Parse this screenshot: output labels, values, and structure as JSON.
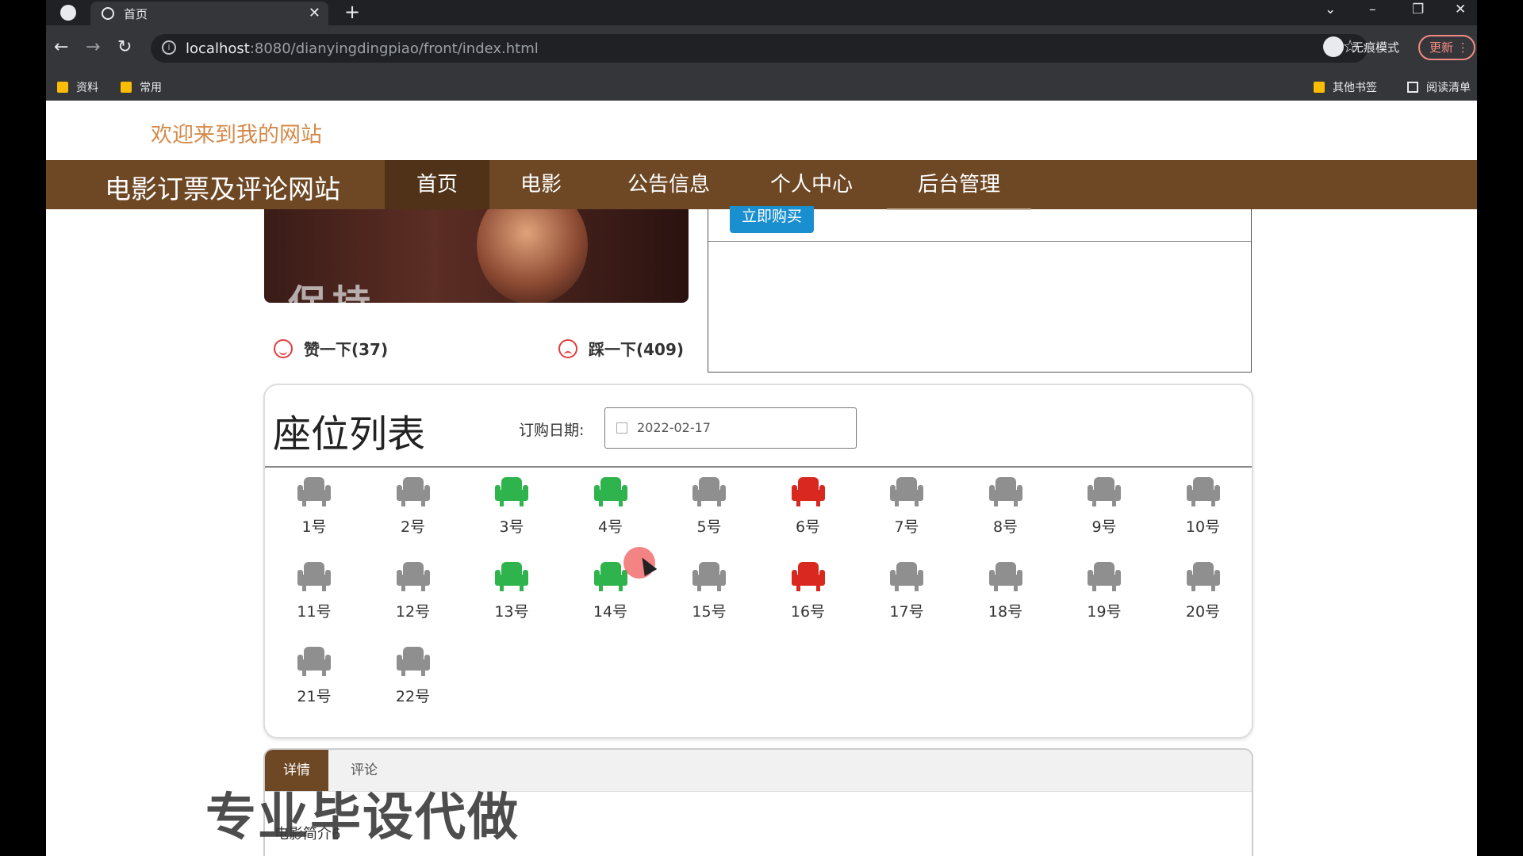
{
  "browser": {
    "tab_title": "首页",
    "url_host": "localhost",
    "url_rest": ":8080/dianyingdingpiao/front/index.html",
    "incognito_label": "无痕模式",
    "update_label": "更新",
    "bookmarks": [
      "资料",
      "常用"
    ],
    "bookmarks_right": [
      "其他书签",
      "阅读清单"
    ]
  },
  "header": {
    "welcome": "欢迎来到我的网站",
    "site_title": "电影订票及评论网站",
    "nav": [
      "首页",
      "电影",
      "公告信息",
      "个人中心",
      "后台管理"
    ]
  },
  "movie": {
    "like_label": "赞一下(37)",
    "dislike_label": "踩一下(409)",
    "buy_label": "立即购买"
  },
  "seats": {
    "title": "座位列表",
    "date_label": "订购日期:",
    "date_value": "2022-02-17",
    "colors": {
      "available": "#8f8f8f",
      "selected": "#2fb44d",
      "sold": "#d9281f"
    },
    "items": [
      {
        "label": "1号",
        "status": "available"
      },
      {
        "label": "2号",
        "status": "available"
      },
      {
        "label": "3号",
        "status": "selected"
      },
      {
        "label": "4号",
        "status": "selected"
      },
      {
        "label": "5号",
        "status": "available"
      },
      {
        "label": "6号",
        "status": "sold"
      },
      {
        "label": "7号",
        "status": "available"
      },
      {
        "label": "8号",
        "status": "available"
      },
      {
        "label": "9号",
        "status": "available"
      },
      {
        "label": "10号",
        "status": "available"
      },
      {
        "label": "11号",
        "status": "available"
      },
      {
        "label": "12号",
        "status": "available"
      },
      {
        "label": "13号",
        "status": "selected"
      },
      {
        "label": "14号",
        "status": "selected"
      },
      {
        "label": "15号",
        "status": "available"
      },
      {
        "label": "16号",
        "status": "sold"
      },
      {
        "label": "17号",
        "status": "available"
      },
      {
        "label": "18号",
        "status": "available"
      },
      {
        "label": "19号",
        "status": "available"
      },
      {
        "label": "20号",
        "status": "available"
      },
      {
        "label": "21号",
        "status": "available"
      },
      {
        "label": "22号",
        "status": "available"
      }
    ]
  },
  "details": {
    "tabs": [
      "详情",
      "评论"
    ],
    "intro": "电影简介6"
  },
  "watermark": "专业毕设代做"
}
